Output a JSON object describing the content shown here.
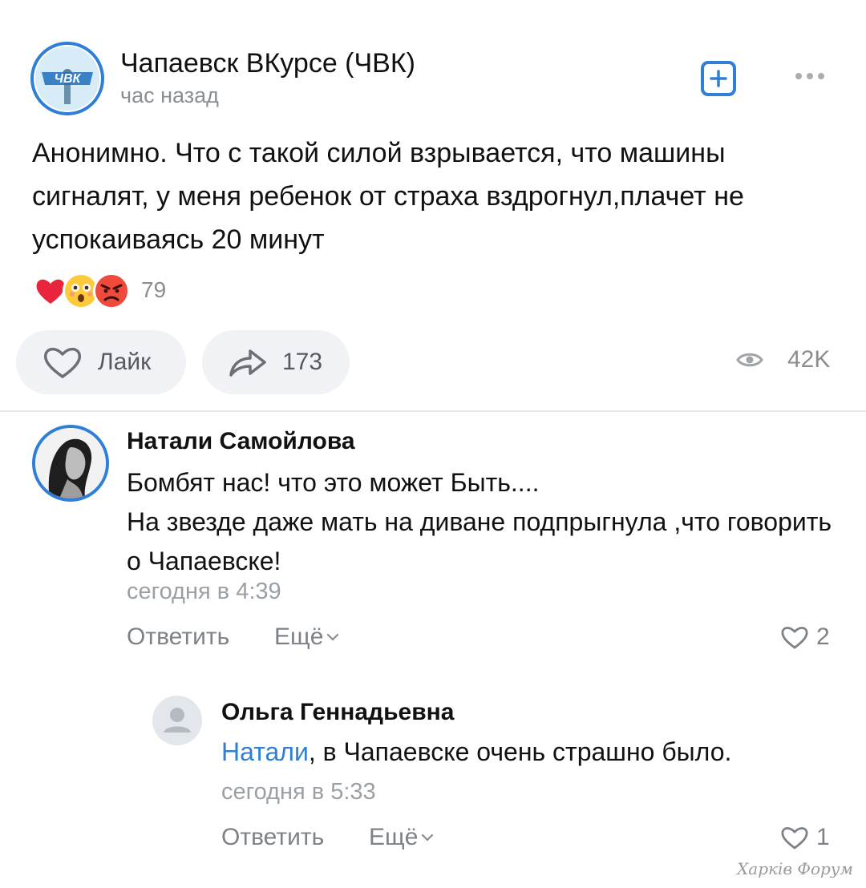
{
  "post": {
    "group_name": "Чапаевск ВКурсе (ЧВК)",
    "time": "час назад",
    "avatar_text": "ЧВК",
    "text": "Анонимно. Что с такой силой взрывается, что машины сигналят, у меня ребенок от страха вздрогнул,плачет не успокаиваясь 20 минут",
    "reactions": {
      "icons": [
        "heart-emoji",
        "astonished-emoji",
        "angry-emoji"
      ],
      "count": "79"
    },
    "actions": {
      "like_label": "Лайк",
      "share_count": "173",
      "views": "42K"
    }
  },
  "comments": [
    {
      "author": "Натали Самойлова",
      "line1": "Бомбят нас! что это может Быть....",
      "line2": "На звезде даже мать на диване подпрыгнула ,что говорить о Чапаевске!",
      "time": "сегодня в 4:39",
      "reply_label": "Ответить",
      "more_label": "Ещё",
      "likes": "2"
    },
    {
      "author": "Ольга Геннадьевна",
      "mention": "Натали",
      "text": ", в Чапаевске очень страшно было.",
      "time": "сегодня в 5:33",
      "reply_label": "Ответить",
      "more_label": "Ещё",
      "likes": "1"
    }
  ],
  "watermark": "Харків Форум",
  "colors": {
    "accent": "#2f7fd8",
    "muted": "#8a8d91",
    "pill_bg": "#f0f2f5"
  }
}
